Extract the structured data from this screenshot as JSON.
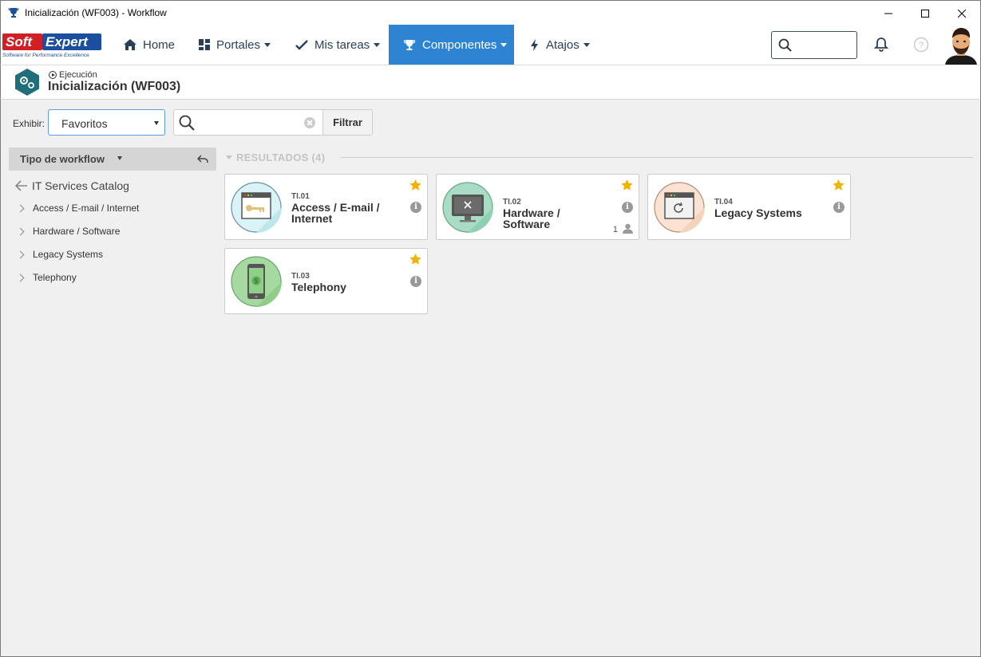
{
  "window": {
    "title": "Inicialización (WF003) - Workflow",
    "icon": "trophy-icon"
  },
  "brand": {
    "logo_text_left": "Soft",
    "logo_text_right": "Expert",
    "tagline": "Software for Performance Excellence",
    "logo_red": "#d11f26",
    "logo_blue": "#1a4fa0"
  },
  "nav": {
    "items": [
      {
        "label": "Home",
        "icon": "home-icon"
      },
      {
        "label": "Portales",
        "icon": "grid-icon"
      },
      {
        "label": "Mis tareas",
        "icon": "check-icon"
      },
      {
        "label": "Componentes",
        "icon": "trophy-icon"
      },
      {
        "label": "Atajos",
        "icon": "bolt-icon"
      }
    ],
    "active": "Componentes",
    "accent": "#2d84d2"
  },
  "header": {
    "breadcrumb": "Ejecución",
    "title": "Inicialización (WF003)"
  },
  "filter": {
    "exhibir_label": "Exhibir:",
    "select_value": "Favoritos",
    "search_value": "",
    "filter_button": "Filtrar"
  },
  "sidebar": {
    "title": "Tipo de workflow",
    "catalog": "IT Services Catalog",
    "items": [
      {
        "label": "Access / E-mail / Internet"
      },
      {
        "label": "Hardware / Software"
      },
      {
        "label": "Legacy Systems"
      },
      {
        "label": "Telephony"
      }
    ]
  },
  "results": {
    "heading": "RESULTADOS (4)",
    "cards": [
      {
        "code": "TI.01",
        "name": "Access / E-mail / Internet",
        "icon": "browser-key-icon",
        "favorite": true,
        "users": ""
      },
      {
        "code": "TI.02",
        "name": "Hardware / Software",
        "icon": "monitor-tools-icon",
        "favorite": true,
        "users": "1"
      },
      {
        "code": "TI.04",
        "name": "Legacy Systems",
        "icon": "browser-refresh-icon",
        "favorite": true,
        "users": ""
      },
      {
        "code": "TI.03",
        "name": "Telephony",
        "icon": "phone-dollar-icon",
        "favorite": true,
        "users": ""
      }
    ],
    "star_color": "#f1b300"
  }
}
